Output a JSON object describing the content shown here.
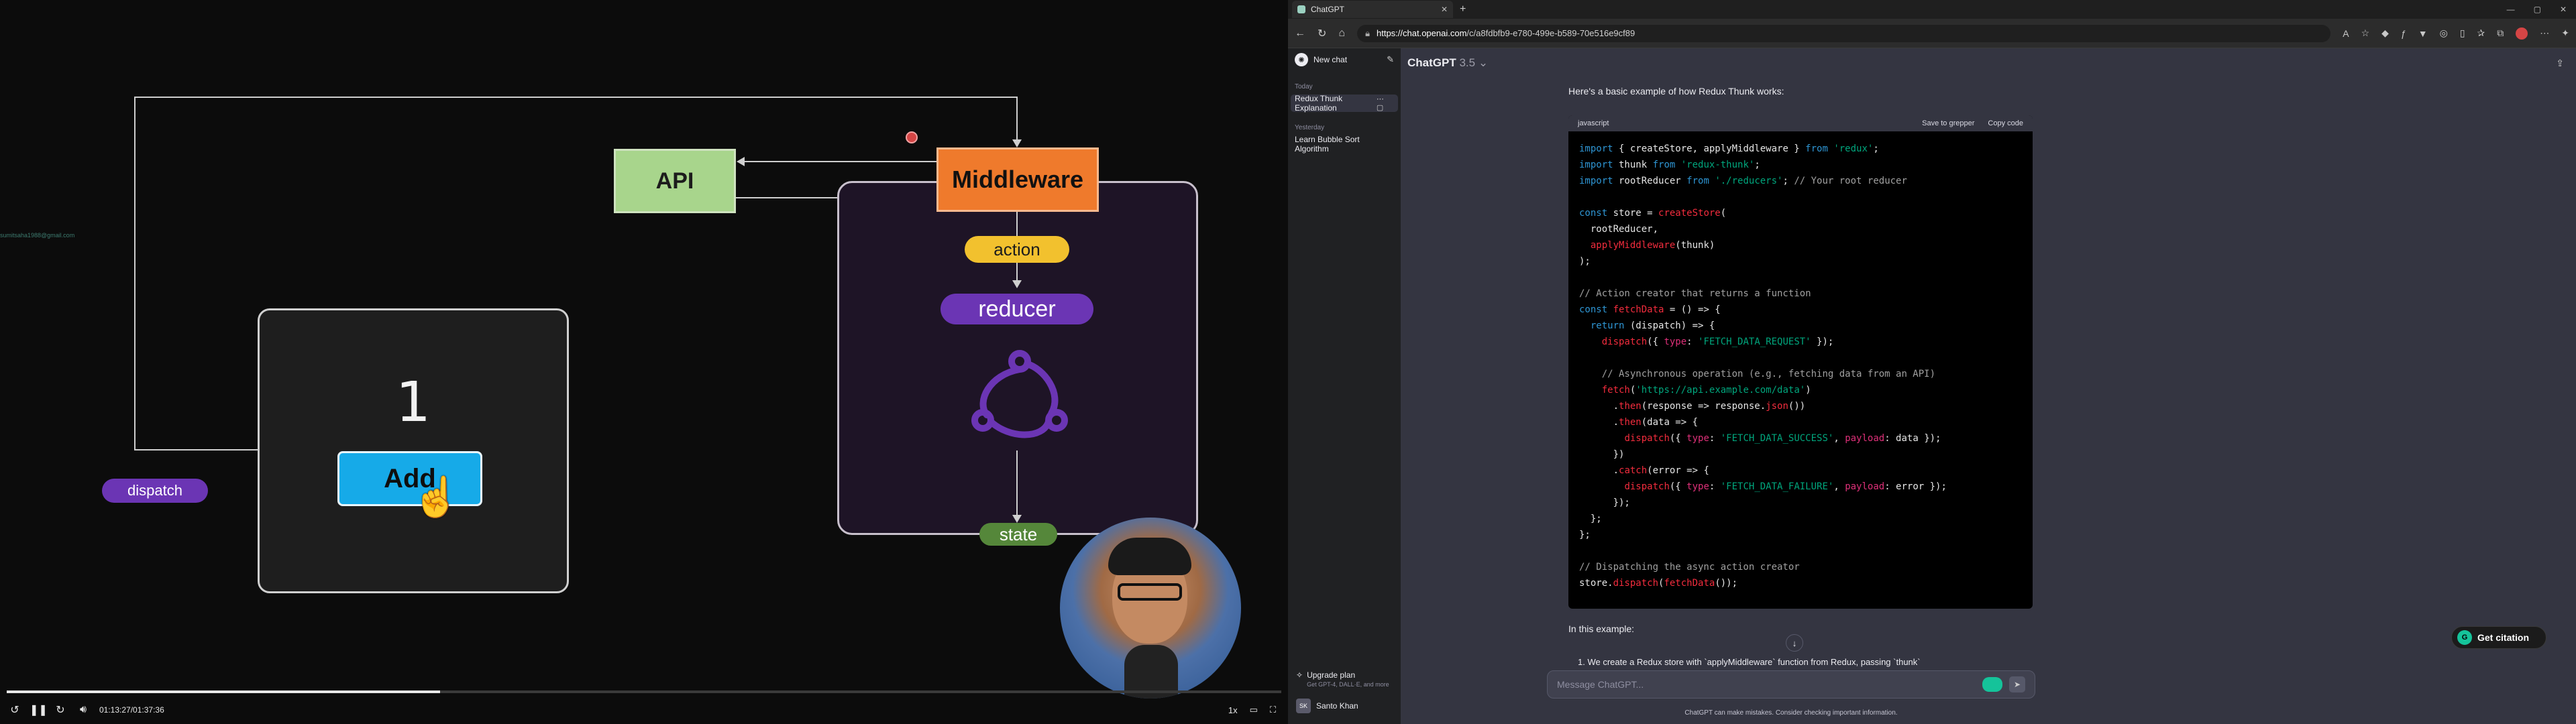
{
  "video": {
    "diagram": {
      "api_label": "API",
      "middleware_label": "Middleware",
      "action_label": "action",
      "reducer_label": "reducer",
      "state_label": "state",
      "dispatch_label": "dispatch",
      "counter_value": "1",
      "add_button_label": "Add",
      "email_watermark": "sumitsaha1988@gmail.com"
    },
    "player": {
      "progress_fraction": 0.34,
      "time": "01:13:27/01:37:36",
      "speed": "1x"
    }
  },
  "browser": {
    "tab_title": "ChatGPT",
    "url_domain": "https://chat.openai.com",
    "url_path": "/c/a8fdbfb9-e780-499e-b589-70e516e9cf89"
  },
  "chatgpt": {
    "sidebar": {
      "new_chat": "New chat",
      "today_label": "Today",
      "yesterday_label": "Yesterday",
      "today_items": [
        "Redux Thunk Explanation"
      ],
      "yesterday_items": [
        "Learn Bubble Sort Algorithm"
      ],
      "upgrade_title": "Upgrade plan",
      "upgrade_sub": "Get GPT-4, DALL·E, and more",
      "user_initials": "SK",
      "user_name": "Santo Khan"
    },
    "model": "ChatGPT",
    "model_version": "3.5",
    "intro": "Here's a basic example of how Redux Thunk works:",
    "code": {
      "language": "javascript",
      "save_label": "Save to grepper",
      "copy_label": "Copy code"
    },
    "in_example": "In this example:",
    "partial_paragraph": "1.  We create a Redux store with `applyMiddleware` function from Redux, passing `thunk`",
    "input_placeholder": "Message ChatGPT...",
    "disclaimer": "ChatGPT can make mistakes. Consider checking important information.",
    "get_citation": "Get citation"
  }
}
